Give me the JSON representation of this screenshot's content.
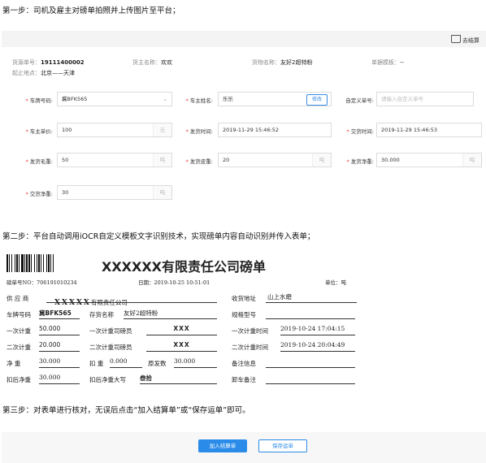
{
  "steps": {
    "step1": "第一步：司机及雇主对磅单拍照并上传图片至平台；",
    "step2": "第二步：平台自动调用iOCR自定义模板文字识别技术，实现磅单内容自动识别并传入表单；",
    "step3": "第三步：对表单进行核对，无误后点击“加入结算单”或“保存运单”即可。"
  },
  "panel": {
    "cart_label": "去结算",
    "meta": {
      "source_no_label": "货源单号：",
      "source_no": "19111400002",
      "owner_label": "货主名称：",
      "owner": "欢欢",
      "goods_label": "货物名称：",
      "goods": "友好2超特粉",
      "template_label": "单据模板：",
      "template": "--",
      "route_label": "起止地点：",
      "route": "北京——天津"
    },
    "fields": {
      "plate_label": "车牌号码:",
      "plate_value": "冀BFK565",
      "driver_label": "车主姓名:",
      "driver_value": "乐乐",
      "modify_label": "修改",
      "custom_no_label": "自定义单号:",
      "custom_no_placeholder": "请输入自定义单号",
      "price_label": "车主单价:",
      "price_value": "100",
      "price_unit": "元",
      "ship_time_label": "发货时间:",
      "ship_time_value": "2019-11-29 15:46:52",
      "deliver_time_label": "交货时间:",
      "deliver_time_value": "2019-11-29 15:46:53",
      "gross_label": "发货毛重:",
      "gross_value": "50",
      "gross_unit": "吨",
      "tare_label": "发货皮重:",
      "tare_value": "20",
      "tare_unit": "吨",
      "net_label": "发货净重:",
      "net_value": "30.000",
      "net_unit": "吨",
      "deliver_net_label": "交货净重:",
      "deliver_net_value": "30",
      "deliver_net_unit": "吨"
    }
  },
  "scale_ticket": {
    "title": "XXXXXX有限责任公司磅单",
    "ticket_no_label": "磅单号NO：",
    "ticket_no": "706191010234",
    "date_label": "日期：",
    "date": "2019-10-25 10:51:01",
    "unit_label": "单位：",
    "unit": "吨",
    "supplier_label": "供 应 商",
    "supplier_bold": "XXXXX",
    "supplier_rest": "有限责任公司",
    "receiver_label": "收货地址",
    "receiver": "山上水磨",
    "plate_label": "车牌号码",
    "plate": "冀BFK565",
    "goods_label": "存货名称",
    "goods": "友好2超特粉",
    "spec_label": "规格型号",
    "spec": "",
    "w1_label": "一次计重",
    "w1": "50.000",
    "w1_op_label": "一次计重司磅员",
    "w1_op": "XXX",
    "w1_time_label": "一次计重时间",
    "w1_time": "2019-10-24 17:04:15",
    "w2_label": "二次计重",
    "w2": "20.000",
    "w2_op_label": "二次计重司磅员",
    "w2_op": "XXX",
    "w2_time_label": "二次计重时间",
    "w2_time": "2019-10-24 20:04:49",
    "net_label": "净 重",
    "net": "30.000",
    "deduct_label": "扣 重",
    "deduct": "0.000",
    "orig_label": "原发数",
    "orig": "30.000",
    "remark_label": "备注信息",
    "remark": "",
    "deduct_net_label": "扣后净重",
    "deduct_net": "30.000",
    "deduct_upper_label": "扣后净重大写",
    "deduct_upper": "叁拾",
    "unload_label": "卸车备注",
    "unload": ""
  },
  "buttons": {
    "add_settlement": "加入结算单",
    "save_waybill": "保存运单"
  },
  "colors": {
    "accent": "#2b8be8",
    "required": "#e33333"
  }
}
